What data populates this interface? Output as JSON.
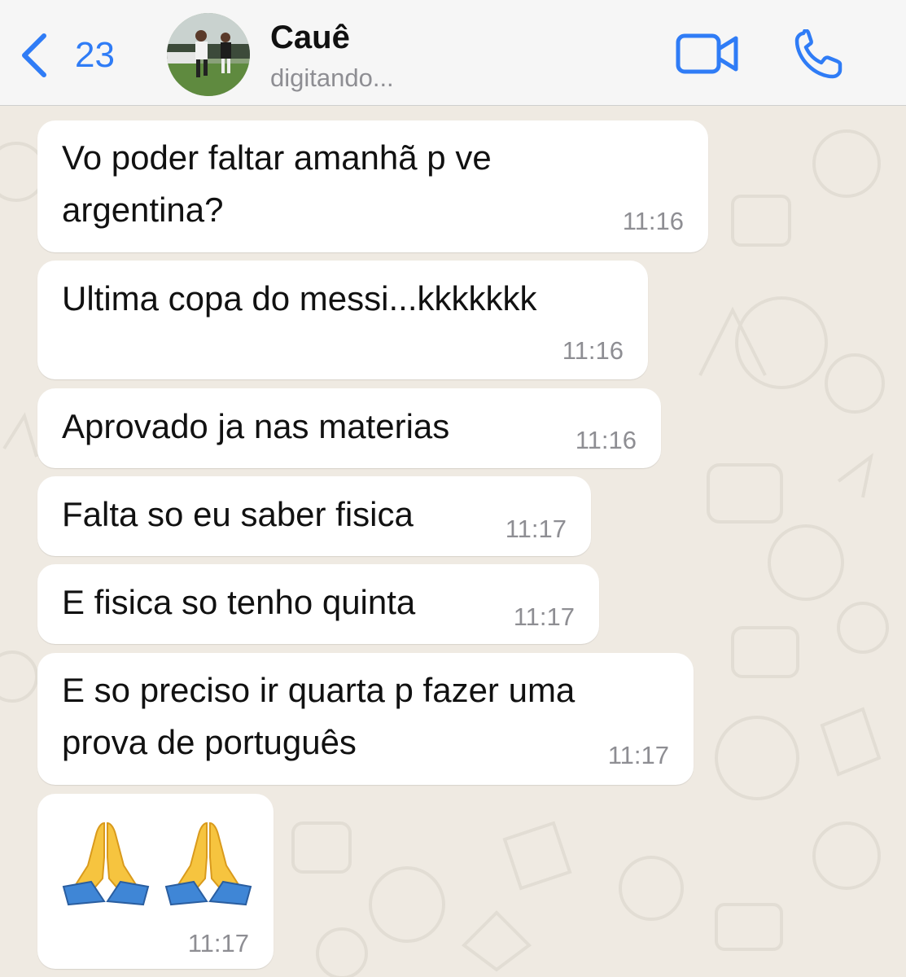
{
  "header": {
    "back_count": "23",
    "contact_name": "Cauê",
    "status": "digitando..."
  },
  "icons": {
    "back": "chevron-left-icon",
    "video": "video-camera-icon",
    "call": "phone-icon"
  },
  "colors": {
    "accent": "#2f7cf6",
    "chat_background": "#efeae2",
    "bubble_background": "#ffffff",
    "timestamp": "#8e8e93"
  },
  "messages": [
    {
      "lines": [
        "Vo poder faltar amanhã p ve",
        "argentina?"
      ],
      "time": "11:16"
    },
    {
      "lines": [
        "Ultima copa do messi...kkkkkkk"
      ],
      "time": "11:16"
    },
    {
      "lines": [
        "Aprovado ja nas materias"
      ],
      "time": "11:16"
    },
    {
      "lines": [
        "Falta so eu saber fisica"
      ],
      "time": "11:17"
    },
    {
      "lines": [
        "E fisica so tenho quinta"
      ],
      "time": "11:17"
    },
    {
      "lines": [
        "E so preciso ir quarta p fazer uma",
        "prova de português"
      ],
      "time": "11:17"
    },
    {
      "emoji": [
        "praying-hands",
        "praying-hands"
      ],
      "time": "11:17"
    }
  ]
}
